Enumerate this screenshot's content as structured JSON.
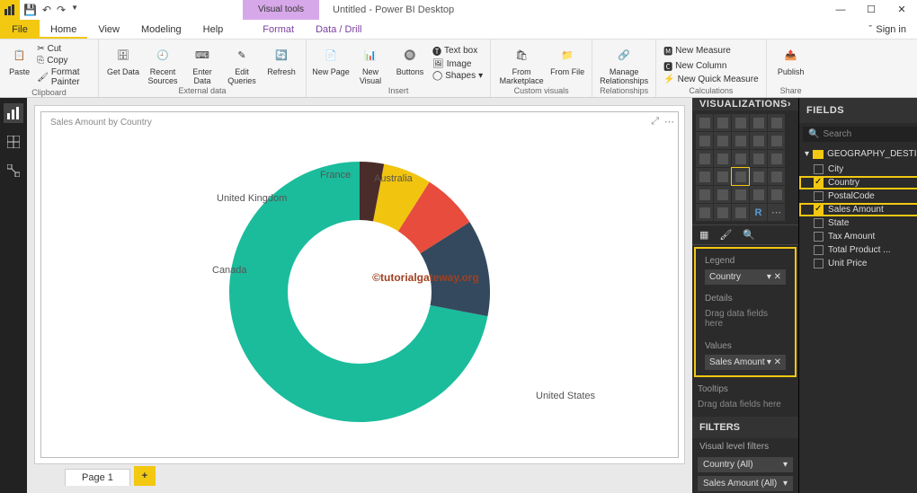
{
  "app": {
    "title": "Untitled - Power BI Desktop",
    "visual_tools": "Visual tools",
    "sign_in": "Sign in"
  },
  "tabs": {
    "file": "File",
    "home": "Home",
    "view": "View",
    "modeling": "Modeling",
    "help": "Help",
    "format": "Format",
    "datadrill": "Data / Drill"
  },
  "ribbon": {
    "clipboard": {
      "label": "Clipboard",
      "paste": "Paste",
      "cut": "Cut",
      "copy": "Copy",
      "fp": "Format Painter"
    },
    "external": {
      "label": "External data",
      "get": "Get\nData",
      "recent": "Recent\nSources",
      "enter": "Enter\nData",
      "edit": "Edit\nQueries",
      "refresh": "Refresh"
    },
    "insert": {
      "label": "Insert",
      "newpage": "New\nPage",
      "newvisual": "New\nVisual",
      "buttons": "Buttons",
      "textbox": "Text box",
      "image": "Image",
      "shapes": "Shapes"
    },
    "custom": {
      "label": "Custom visuals",
      "market": "From\nMarketplace",
      "file": "From\nFile"
    },
    "rel": {
      "label": "Relationships",
      "manage": "Manage\nRelationships"
    },
    "calc": {
      "label": "Calculations",
      "nm": "New Measure",
      "nc": "New Column",
      "nqm": "New Quick Measure"
    },
    "share": {
      "label": "Share",
      "publish": "Publish"
    }
  },
  "chart": {
    "title": "Sales Amount by Country",
    "watermark": "©tutorialgateway.org",
    "labels": {
      "us": "United States",
      "ca": "Canada",
      "uk": "United Kingdom",
      "fr": "France",
      "au": "Australia"
    }
  },
  "page": {
    "p1": "Page 1"
  },
  "panes": {
    "viz": "VISUALIZATIONS",
    "fields": "FIELDS",
    "search": "Search",
    "filters": "FILTERS",
    "vlf": "Visual level filters"
  },
  "wells": {
    "legend": "Legend",
    "legendItem": "Country",
    "details": "Details",
    "drag": "Drag data fields here",
    "values": "Values",
    "valuesItem": "Sales Amount",
    "tooltips": "Tooltips"
  },
  "filters": {
    "country": "Country  (All)",
    "sales": "Sales Amount  (All)"
  },
  "table": {
    "name": "GEOGRAPHY_DESTI..."
  },
  "fields": {
    "city": "City",
    "country": "Country",
    "postal": "PostalCode",
    "sales": "Sales Amount",
    "state": "State",
    "tax": "Tax Amount",
    "total": "Total Product ...",
    "unit": "Unit Price"
  },
  "chart_data": {
    "type": "pie",
    "title": "Sales Amount by Country",
    "series": [
      {
        "name": "United States",
        "value": 72,
        "color": "#1abc9c"
      },
      {
        "name": "Canada",
        "value": 12,
        "color": "#34495e"
      },
      {
        "name": "United Kingdom",
        "value": 7,
        "color": "#e74c3c"
      },
      {
        "name": "France",
        "value": 6,
        "color": "#f1c40f"
      },
      {
        "name": "Australia",
        "value": 3,
        "color": "#4a2c2a"
      }
    ],
    "donut_inner_ratio": 0.55
  }
}
